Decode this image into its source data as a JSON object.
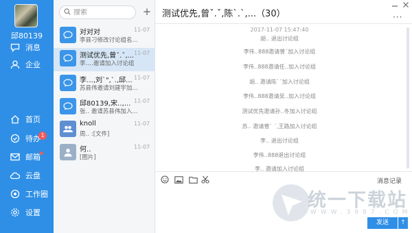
{
  "sidebar": {
    "username": "邱80139",
    "items": [
      {
        "label": "消息",
        "icon": "chat-icon"
      },
      {
        "label": "企业",
        "icon": "contacts-icon"
      },
      {
        "label": "首页",
        "icon": "home-icon"
      },
      {
        "label": "待办",
        "icon": "todo-icon",
        "badge": "1"
      },
      {
        "label": "邮箱",
        "icon": "mail-icon"
      },
      {
        "label": "云盘",
        "icon": "cloud-icon"
      },
      {
        "label": "工作圈",
        "icon": "work-circle-icon"
      },
      {
        "label": "设置",
        "icon": "settings-icon"
      }
    ],
    "colors": {
      "background": "#2f8fe7",
      "badge": "#f05a5a"
    }
  },
  "search": {
    "placeholder": "搜索"
  },
  "conversations": [
    {
      "title": "对对对",
      "subtitle": "李县刁修改讨论组名...",
      "date": "11-07",
      "icon": "chat-bubble-icon"
    },
    {
      "title": "测试优先,曾ˇ.ˇ,...",
      "subtitle": "李‥‥邀请加入讨论组",
      "date": "11-07",
      "icon": "chat-bubble-icon"
    },
    {
      "title": "李‥.,刘ˋ\",ˋ.,邱...",
      "subtitle": "苏县伟邀请刘建宇加...",
      "date": "11-07",
      "icon": "chat-bubble-icon"
    },
    {
      "title": "邱80139,宋‥,...",
      "subtitle": "张‥ 邀请苏县伟加入...",
      "date": "11-07",
      "icon": "chat-bubble-icon"
    },
    {
      "title": "knoll",
      "subtitle": "周‥ :[文件]",
      "date": "11-07",
      "icon": "group-icon"
    },
    {
      "title": "何‥",
      "subtitle": "[图片]",
      "date": "11-07",
      "icon": "person-icon"
    }
  ],
  "chat": {
    "title": "测试优先,曾ˇ.ˇ,陈ˋ.ˋ,...（30）",
    "messages": [
      {
        "text": "2017-11-07 15:47:40",
        "kind": "time"
      },
      {
        "text": "胡‥ 退出讨论组",
        "kind": "system"
      },
      {
        "text": "李伟‥888邀请曾ˊ加入讨论组",
        "kind": "system"
      },
      {
        "text": "李伟‥888邀请任‥加入讨论组",
        "kind": "system"
      },
      {
        "text": "胡‥ 邀请陈ˋˊ加入讨论组",
        "kind": "system"
      },
      {
        "text": "李伟‥888邀请吴‥加入讨论组",
        "kind": "system"
      },
      {
        "text": "测试优先邀请孙‥冬加入讨论组",
        "kind": "system"
      },
      {
        "text": "苏‥ 邀请曾ˋ ˊ,王路加入讨论组",
        "kind": "system"
      },
      {
        "text": "李‥ 退出讨论组",
        "kind": "system"
      },
      {
        "text": "李伟‥888退出讨论组",
        "kind": "system"
      },
      {
        "text": "李‥ 邀请加入讨论组",
        "kind": "system"
      }
    ],
    "toolbar": {
      "emoji_icon": "emoji-icon",
      "image_icon": "image-icon",
      "folder_icon": "folder-icon",
      "cut_icon": "scissors-icon"
    },
    "history_label": "消息记录",
    "send_label": "发送",
    "send_options_label": "↑",
    "more_label": "···",
    "accent": "#2f8fe7"
  },
  "watermark": {
    "text": "统一下载站",
    "sub": "WWW.3987.COM"
  }
}
